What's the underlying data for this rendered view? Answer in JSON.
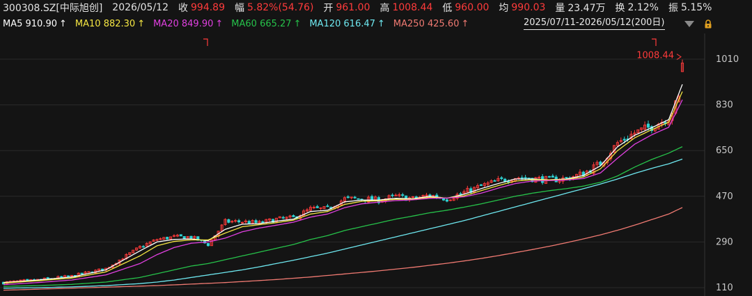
{
  "header": {
    "symbol": "300308.SZ[中际旭创]",
    "date": "2026/05/12",
    "close_label": "收",
    "close": "994.89",
    "change_label": "幅",
    "change": "5.82%(54.76)",
    "open_label": "开",
    "open": "961.00",
    "high_label": "高",
    "high": "1008.44",
    "low_label": "低",
    "low": "960.00",
    "avg_label": "均",
    "avg": "990.03",
    "volume_label": "量",
    "volume": "23.47万",
    "turnover_label": "换",
    "turnover": "2.12%",
    "amplitude_label": "振",
    "amplitude": "5.15%"
  },
  "ma_legend": [
    {
      "label": "MA5 910.90",
      "color": "#ffffff",
      "arrow": "↑"
    },
    {
      "label": "MA10 882.30",
      "color": "#f5e642",
      "arrow": "↑"
    },
    {
      "label": "MA20 849.90",
      "color": "#e040e0",
      "arrow": "↑"
    },
    {
      "label": "MA60 665.27",
      "color": "#26c24a",
      "arrow": "↑"
    },
    {
      "label": "MA120 616.47",
      "color": "#6ee8f0",
      "arrow": "↑"
    },
    {
      "label": "MA250 425.60",
      "color": "#f07a72",
      "arrow": "↑"
    }
  ],
  "range_label": "2025/07/11-2026/05/12(200日)",
  "colors": {
    "up": "#ff3b3b",
    "down": "#2fd3d3",
    "grid": "#2a2a2a",
    "axis_text": "#c8c8c8",
    "background": "#141414"
  },
  "chart_data": {
    "type": "candlestick",
    "date_range": [
      "2025/07/11",
      "2026/05/12"
    ],
    "num_bars": 200,
    "y_ticks": [
      110,
      290,
      470,
      650,
      830,
      1010
    ],
    "ylim": [
      100,
      1055
    ],
    "high_marker": "1008.44",
    "grid": true,
    "close_series": {
      "x": [
        0,
        10,
        20,
        30,
        40,
        45,
        50,
        55,
        60,
        65,
        70,
        75,
        80,
        85,
        90,
        95,
        100,
        105,
        110,
        115,
        120,
        125,
        130,
        135,
        140,
        145,
        150,
        155,
        160,
        165,
        170,
        175,
        180,
        185,
        190,
        195,
        199
      ],
      "y": [
        130,
        140,
        155,
        185,
        270,
        300,
        310,
        310,
        280,
        370,
        370,
        365,
        380,
        385,
        420,
        420,
        460,
        460,
        455,
        470,
        460,
        475,
        460,
        485,
        510,
        530,
        545,
        540,
        535,
        540,
        560,
        600,
        680,
        720,
        745,
        780,
        880
      ]
    },
    "ma_series": [
      {
        "name": "MA5",
        "values_at_x": [
          130,
          140,
          152,
          180,
          255,
          290,
          300,
          302,
          295,
          340,
          360,
          362,
          372,
          380,
          410,
          415,
          448,
          455,
          455,
          462,
          460,
          470,
          462,
          478,
          500,
          520,
          538,
          538,
          535,
          538,
          552,
          590,
          665,
          710,
          740,
          772,
          910.9
        ]
      },
      {
        "name": "MA10",
        "values_at_x": [
          128,
          137,
          148,
          172,
          235,
          275,
          292,
          298,
          298,
          325,
          350,
          358,
          366,
          376,
          400,
          410,
          438,
          450,
          452,
          458,
          458,
          466,
          463,
          472,
          492,
          512,
          530,
          535,
          535,
          536,
          546,
          578,
          650,
          700,
          732,
          762,
          882.3
        ]
      },
      {
        "name": "MA20",
        "values_at_x": [
          122,
          130,
          140,
          160,
          205,
          240,
          268,
          285,
          290,
          305,
          330,
          345,
          356,
          368,
          388,
          400,
          425,
          440,
          447,
          453,
          456,
          462,
          463,
          468,
          482,
          502,
          520,
          530,
          532,
          534,
          540,
          562,
          620,
          675,
          712,
          742,
          849.9
        ]
      },
      {
        "name": "MA60",
        "values_at_x": [
          115,
          118,
          123,
          132,
          150,
          165,
          180,
          195,
          205,
          220,
          235,
          250,
          265,
          280,
          300,
          315,
          335,
          350,
          365,
          380,
          392,
          405,
          415,
          427,
          440,
          455,
          470,
          482,
          492,
          500,
          510,
          525,
          550,
          585,
          615,
          640,
          665.27
        ]
      },
      {
        "name": "MA120",
        "values_at_x": [
          108,
          110,
          113,
          118,
          126,
          132,
          140,
          150,
          160,
          170,
          180,
          192,
          205,
          218,
          232,
          246,
          262,
          278,
          294,
          310,
          326,
          342,
          358,
          374,
          392,
          410,
          428,
          446,
          464,
          482,
          500,
          518,
          538,
          560,
          580,
          598,
          616.47
        ]
      },
      {
        "name": "MA250",
        "values_at_x": [
          100,
          104,
          108,
          112,
          116,
          118,
          121,
          124,
          127,
          130,
          134,
          138,
          142,
          147,
          152,
          158,
          164,
          170,
          176,
          183,
          190,
          198,
          206,
          215,
          225,
          236,
          248,
          260,
          273,
          287,
          302,
          318,
          336,
          356,
          378,
          400,
          425.6
        ]
      }
    ]
  }
}
